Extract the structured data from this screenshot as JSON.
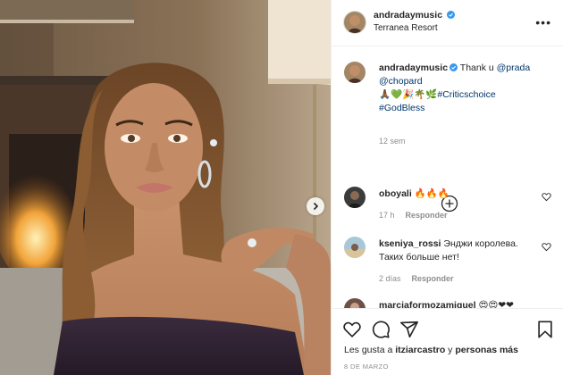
{
  "post": {
    "username": "andradaymusic",
    "location": "Terranea Resort",
    "caption_prefix": "Thank u ",
    "mention_1": "@prada",
    "mention_2": "@chopard",
    "caption_emojis": "🙏🏾💚🎉🌴🌿",
    "hashtag_1": "#Criticschoice",
    "hashtag_2": "#GodBless",
    "caption_time": "12 sem"
  },
  "comments": [
    {
      "username": "oboyali",
      "text": "🔥🔥🔥",
      "time": "17 h",
      "reply": "Responder"
    },
    {
      "username": "kseniya_rossi",
      "text": "Энджи королева. Таких больше нет!",
      "time": "2 días",
      "reply": "Responder"
    },
    {
      "username": "marciaformozamiguel",
      "text": "😍😍❤❤"
    }
  ],
  "likes": {
    "prefix": "Les gusta a ",
    "user": "itziarcastro",
    "middle": " y ",
    "others": "personas más"
  },
  "date": "8 DE MARZO",
  "colors": {
    "verified": "#3897f0",
    "link": "#00376b",
    "muted": "#8e8e8e",
    "border": "#efefef"
  },
  "icons": [
    "verified-badge-icon",
    "more-options-icon",
    "plus-circle-icon",
    "heart-icon",
    "comment-icon",
    "share-icon",
    "bookmark-icon",
    "chevron-right-icon"
  ]
}
